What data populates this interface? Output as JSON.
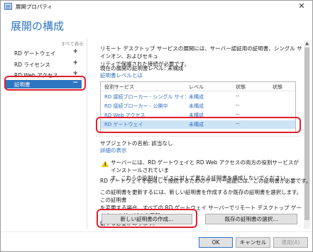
{
  "window": {
    "title": "展開プロパティ",
    "close_glyph": "✕"
  },
  "heading": "展開の構成",
  "sidebar": {
    "show_all": "すべて表示",
    "items": [
      {
        "label": "RD ゲートウェイ",
        "sign": "+"
      },
      {
        "label": "RD ライセンス",
        "sign": "+"
      },
      {
        "label": "RD Web アクセス",
        "sign": "+"
      },
      {
        "label": "証明書",
        "sign": "−"
      }
    ]
  },
  "main": {
    "intro_line1": "リモート デスクトップ サービスの展開には、サーバー認証用の証明書、シングル サインオン、およびセキュ",
    "intro_line2": "リティで保護された接続が必要です。",
    "cert_level": "現在の展開の証明書レベル: 未構成",
    "cert_level_link": "証明書レベルとは",
    "table": {
      "headers": [
        "役割サービス",
        "レベル",
        "状態",
        "状態"
      ],
      "rows": [
        {
          "name": "RD 接続ブローカー - シングル サインオンの有効化",
          "level": "未構成",
          "state": "--",
          "state2": ""
        },
        {
          "name": "RD 接続ブローカー - 公開中",
          "level": "未構成",
          "state": "--",
          "state2": ""
        },
        {
          "name": "RD Web アクセス",
          "level": "未構成",
          "state": "--",
          "state2": ""
        },
        {
          "name": "RD ゲートウェイ",
          "level": "未構成",
          "state": "--",
          "state2": ""
        }
      ]
    },
    "subject_name": "サブジェクトの名前: 該当なし",
    "details_link": "詳細の表示",
    "warning_line1": "サーバーには、RD ゲートウェイと RD Web アクセスの両方の役割サービスがインストールされていま",
    "warning_line2": "す。これらの役割サービスに対して異なる証明書を構成しないでください。",
    "requirement": "RD ゲートウェイを使用して接続するためのサーバー認証には、この証明書が必要です。",
    "update_line1": "この証明書を更新するには、新しい証明書を作成するか既存の証明書を選択します。この証明書",
    "update_line2": "を変更する場合、すべての RD ゲートウェイ サーバーでリモート デスクトップ ゲートウェイ サービスを再起",
    "update_line3": "動する必要があります。",
    "create_button": "新しい証明書の作成...",
    "select_button": "既存の証明書の選択..."
  },
  "footer": {
    "ok": "OK",
    "cancel": "キャンセル",
    "apply": "適用(A)"
  },
  "colors": {
    "accent": "#2f76c1",
    "link": "#2f6fbf",
    "highlight": "#e0202d",
    "warning": "#f2c500",
    "selected_row": "#cde4f7"
  }
}
